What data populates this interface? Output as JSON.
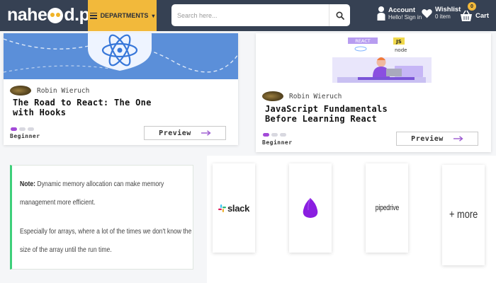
{
  "header": {
    "logo_prefix": "nahe",
    "logo_suffix": "d.pk",
    "departments_label": "DEPARTMENTS",
    "departments_caret": "▾",
    "search_placeholder": "Search here...",
    "account_title": "Account",
    "account_sub": "Hello! Sign in",
    "wishlist_title": "Wishlist",
    "wishlist_sub": "0 item",
    "cart_label": "Cart",
    "cart_count": "0",
    "colors": {
      "bar": "#364153",
      "accent": "#f2b93b"
    }
  },
  "courses": [
    {
      "author": "Robin Wieruch",
      "title_line1": "The Road to React: The One",
      "title_line2": "with Hooks",
      "level": "Beginner",
      "preview_label": "Preview",
      "progress_steps": 3,
      "progress_done": 1
    },
    {
      "author": "Robin Wieruch",
      "title_line1": "JavaScript Fundamentals",
      "title_line2": "Before Learning React",
      "level": "Beginner",
      "preview_label": "Preview",
      "progress_steps": 3,
      "progress_done": 1,
      "badges": [
        "REACT",
        "JS",
        "node"
      ]
    }
  ],
  "note": {
    "label": "Note:",
    "line1": "Dynamic memory allocation can make memory",
    "line2": "management more efficient.",
    "line3": "Especially for arrays, where a lot of the times we don't know the",
    "line4": "size of the array until the run time."
  },
  "brands": {
    "slack": "slack",
    "pipedrive": "pipedrive",
    "more": "+ more"
  }
}
